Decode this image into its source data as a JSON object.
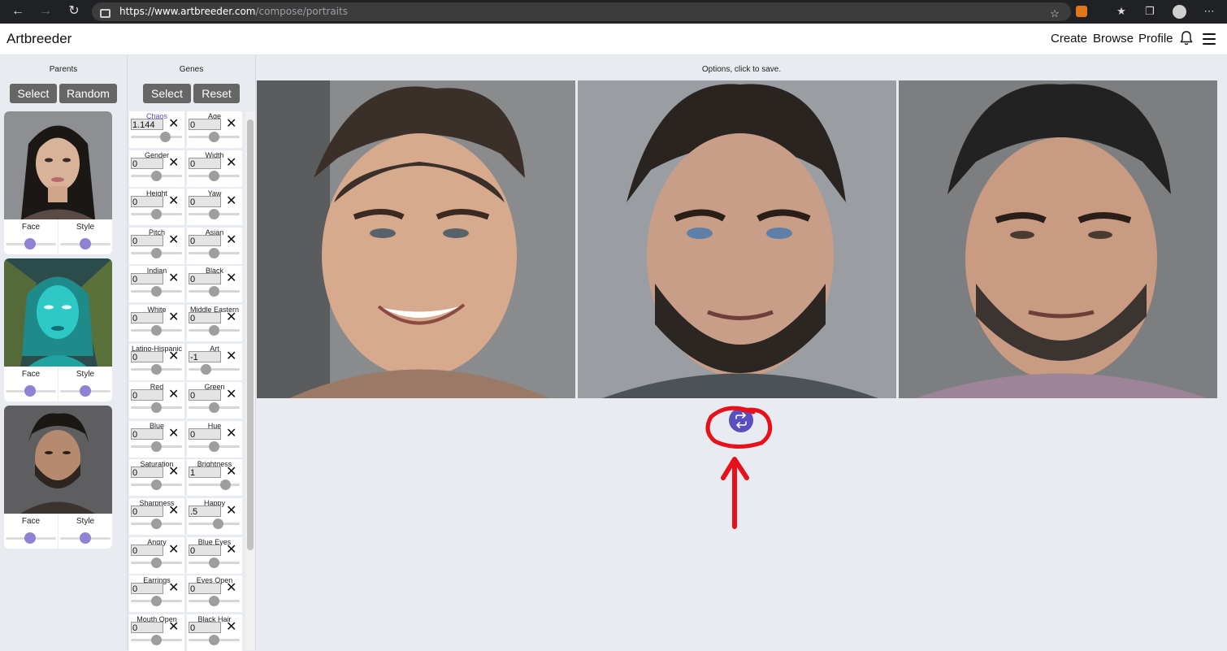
{
  "browser": {
    "url_host": "https://www.artbreeder.com",
    "url_path": "/compose/portraits",
    "icons": [
      "back-icon",
      "forward-icon",
      "reload-icon",
      "lock-icon",
      "star-add-icon",
      "metamask-fox-icon",
      "favorites-icon",
      "collections-icon",
      "profile-icon",
      "more-icon"
    ]
  },
  "app": {
    "brand": "Artbreeder",
    "menu": [
      "Create",
      "Browse",
      "Profile"
    ],
    "accent": "#5b4fc0"
  },
  "parents": {
    "title": "Parents",
    "select_label": "Select",
    "random_label": "Random",
    "cards": [
      {
        "face_label": "Face",
        "style_label": "Style",
        "face": 0.5,
        "style": 0.5
      },
      {
        "face_label": "Face",
        "style_label": "Style",
        "face": 0.5,
        "style": 0.5
      },
      {
        "face_label": "Face",
        "style_label": "Style",
        "face": 0.5,
        "style": 0.5
      }
    ]
  },
  "genes": {
    "title": "Genes",
    "select_label": "Select",
    "reset_label": "Reset",
    "items": [
      {
        "label": "Chaos",
        "value": "1.144",
        "slider": 0.72,
        "active": true
      },
      {
        "label": "Age",
        "value": "0",
        "slider": 0.5
      },
      {
        "label": "Gender",
        "value": "0",
        "slider": 0.5
      },
      {
        "label": "Width",
        "value": "0",
        "slider": 0.5
      },
      {
        "label": "Height",
        "value": "0",
        "slider": 0.5
      },
      {
        "label": "Yaw",
        "value": "0",
        "slider": 0.5
      },
      {
        "label": "Pitch",
        "value": "0",
        "slider": 0.5
      },
      {
        "label": "Asian",
        "value": "0",
        "slider": 0.5
      },
      {
        "label": "Indian",
        "value": "0",
        "slider": 0.5
      },
      {
        "label": "Black",
        "value": "0",
        "slider": 0.5
      },
      {
        "label": "White",
        "value": "0",
        "slider": 0.5
      },
      {
        "label": "Middle Eastern",
        "value": "0",
        "slider": 0.5
      },
      {
        "label": "Latino-Hispanic",
        "value": "0",
        "slider": 0.5
      },
      {
        "label": "Art",
        "value": "-1",
        "slider": 0.3
      },
      {
        "label": "Red",
        "value": "0",
        "slider": 0.5
      },
      {
        "label": "Green",
        "value": "0",
        "slider": 0.5
      },
      {
        "label": "Blue",
        "value": "0",
        "slider": 0.5
      },
      {
        "label": "Hue",
        "value": "0",
        "slider": 0.5
      },
      {
        "label": "Saturation",
        "value": "0",
        "slider": 0.5
      },
      {
        "label": "Brightness",
        "value": "1",
        "slider": 0.78
      },
      {
        "label": "Sharpness",
        "value": "0",
        "slider": 0.5
      },
      {
        "label": "Happy",
        "value": ".5",
        "slider": 0.6
      },
      {
        "label": "Angry",
        "value": "0",
        "slider": 0.5
      },
      {
        "label": "Blue Eyes",
        "value": "0",
        "slider": 0.5
      },
      {
        "label": "Earrings",
        "value": "0",
        "slider": 0.5
      },
      {
        "label": "Eyes Open",
        "value": "0",
        "slider": 0.5
      },
      {
        "label": "Mouth Open",
        "value": "0",
        "slider": 0.5
      },
      {
        "label": "Black Hair",
        "value": "0",
        "slider": 0.5
      }
    ]
  },
  "options": {
    "title": "Options, click to save."
  }
}
